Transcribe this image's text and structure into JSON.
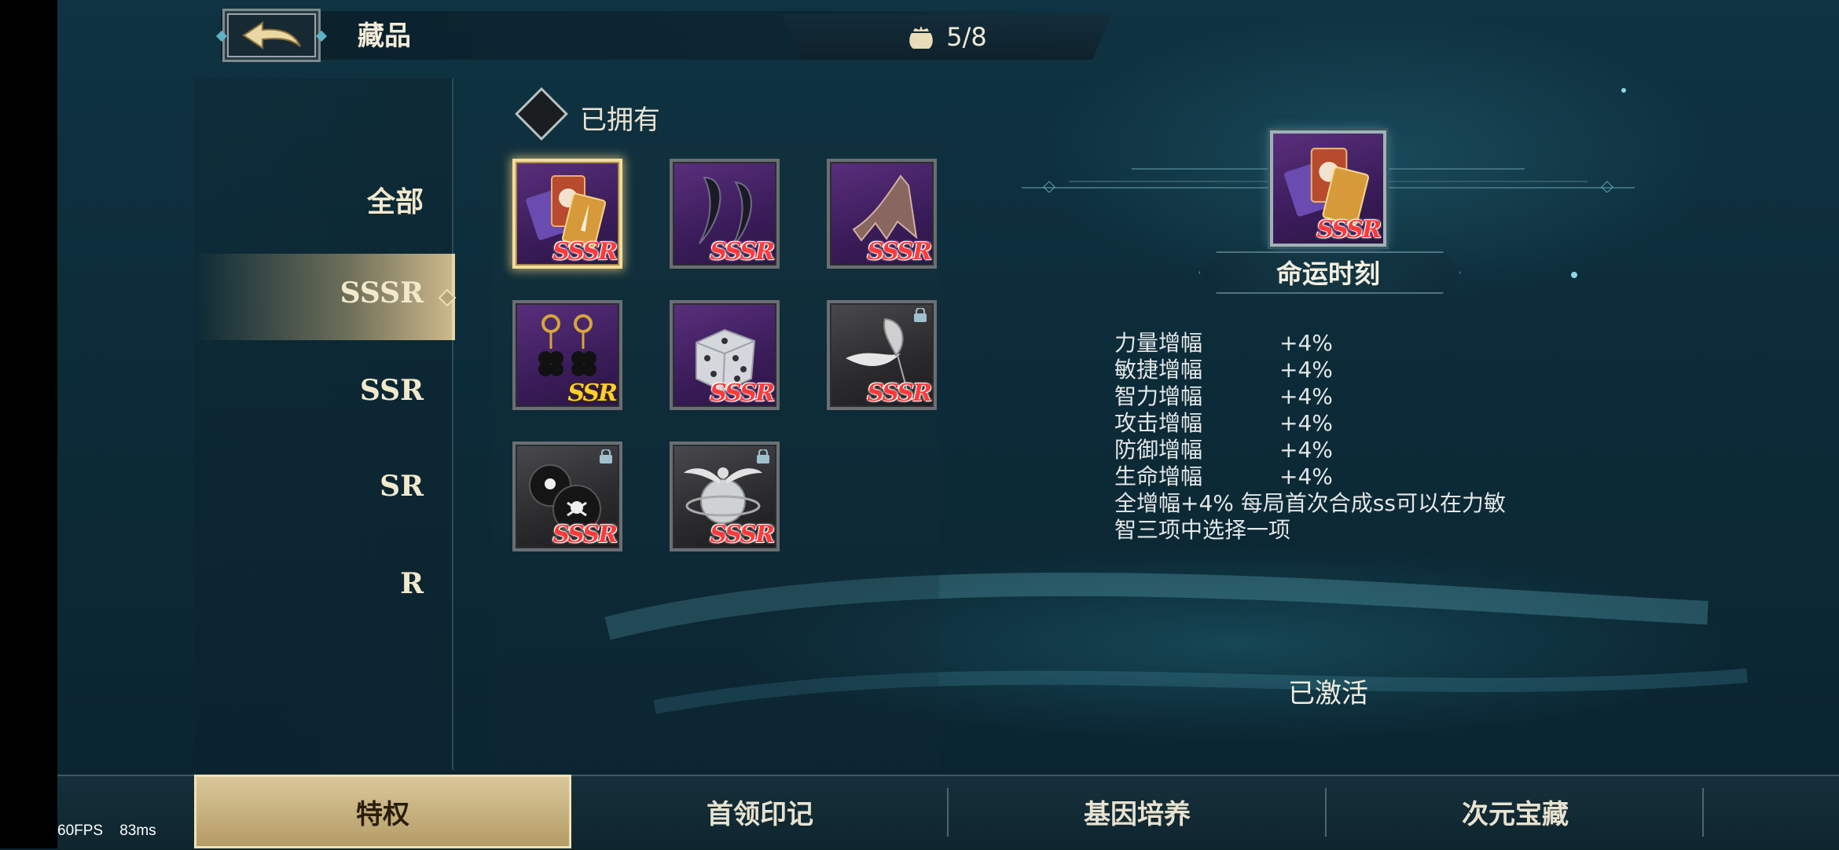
{
  "header": {
    "title": "藏品",
    "count": "5/8",
    "back_icon": "back-arrow-icon"
  },
  "sidebar": {
    "items": [
      {
        "label": "全部",
        "active": false
      },
      {
        "label": "SSSR",
        "active": true
      },
      {
        "label": "SSR",
        "active": false
      },
      {
        "label": "SR",
        "active": false
      },
      {
        "label": "R",
        "active": false
      }
    ]
  },
  "filter": {
    "owned_label": "已拥有"
  },
  "items": [
    {
      "art": "fate-cards",
      "rarity": "SSSR",
      "locked": false,
      "selected": true
    },
    {
      "art": "black-claws",
      "rarity": "SSSR",
      "locked": false,
      "selected": false
    },
    {
      "art": "demon-wing",
      "rarity": "SSSR",
      "locked": false,
      "selected": false
    },
    {
      "art": "clover-earrings",
      "rarity": "SSR",
      "locked": false,
      "selected": false
    },
    {
      "art": "dice",
      "rarity": "SSSR",
      "locked": false,
      "selected": false
    },
    {
      "art": "feather-ornament",
      "rarity": "SSSR",
      "locked": true,
      "selected": false
    },
    {
      "art": "skull-bombs",
      "rarity": "SSSR",
      "locked": true,
      "selected": false
    },
    {
      "art": "winged-orb",
      "rarity": "SSSR",
      "locked": true,
      "selected": false
    }
  ],
  "detail": {
    "name": "命运时刻",
    "stats": [
      {
        "name": "力量增幅",
        "value": "+4%"
      },
      {
        "name": "敏捷增幅",
        "value": "+4%"
      },
      {
        "name": "智力增幅",
        "value": "+4%"
      },
      {
        "name": "攻击增幅",
        "value": "+4%"
      },
      {
        "name": "防御增幅",
        "value": "+4%"
      },
      {
        "name": "生命增幅",
        "value": "+4%"
      }
    ],
    "description_line1": "全增幅+4% 每局首次合成ss可以在力敏",
    "description_line2": "智三项中选择一项",
    "status": "已激活"
  },
  "tabs": [
    {
      "label": "特权",
      "active": true
    },
    {
      "label": "首领印记",
      "active": false
    },
    {
      "label": "基因培养",
      "active": false
    },
    {
      "label": "次元宝藏",
      "active": false
    }
  ],
  "overlay": {
    "fps": "60FPS",
    "ms": "83ms"
  },
  "colors": {
    "sssr": "#ff3a3a",
    "ssr": "#ffcf2e",
    "accent": "#d9c79a"
  }
}
